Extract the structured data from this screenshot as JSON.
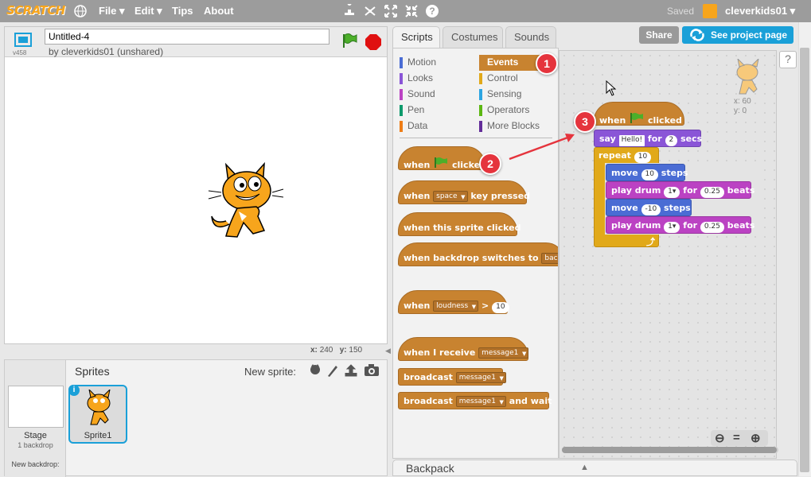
{
  "menu": {
    "logo": "SCRATCH",
    "file": "File ▾",
    "edit": "Edit ▾",
    "tips": "Tips",
    "about": "About",
    "saved": "Saved",
    "user": "cleverkids01 ▾"
  },
  "project": {
    "title": "Untitled-4",
    "byline": "by cleverkids01 (unshared)",
    "version": "v458"
  },
  "stage_coords": {
    "x_label": "x:",
    "x": "240",
    "y_label": "y:",
    "y": "150"
  },
  "sprites": {
    "header": "Sprites",
    "new_sprite": "New sprite:",
    "stage_label": "Stage",
    "stage_sub": "1 backdrop",
    "new_backdrop": "New backdrop:",
    "sprite1": "Sprite1"
  },
  "tabs": {
    "scripts": "Scripts",
    "costumes": "Costumes",
    "sounds": "Sounds"
  },
  "categories": {
    "motion": "Motion",
    "looks": "Looks",
    "sound": "Sound",
    "pen": "Pen",
    "data": "Data",
    "events": "Events",
    "control": "Control",
    "sensing": "Sensing",
    "operators": "Operators",
    "more": "More Blocks"
  },
  "palette": {
    "when": "when",
    "clicked": "clicked",
    "space": "space",
    "key_pressed": "key pressed",
    "when_sprite_clicked": "when this sprite clicked",
    "when_backdrop": "when backdrop switches to",
    "backdrop_opt": "backdr",
    "loudness": "loudness",
    "gt": ">",
    "ten": "10",
    "when_receive": "when I receive",
    "message1": "message1",
    "broadcast": "broadcast",
    "and_wait": "and wait"
  },
  "script": {
    "when": "when",
    "clicked": "clicked",
    "say": "say",
    "hello": "Hello!",
    "for": "for",
    "two": "2",
    "secs": "secs",
    "repeat": "repeat",
    "ten": "10",
    "move": "move",
    "steps": "steps",
    "neg_ten": "-10",
    "play_drum": "play drum",
    "drum_num": "1",
    "beats": "beats",
    "quarter": "0.25"
  },
  "sprite_pos": {
    "x": "x: 60",
    "y": "y: 0"
  },
  "buttons": {
    "share": "Share",
    "see_project": "See project page"
  },
  "backpack": "Backpack",
  "markers": {
    "m1": "1",
    "m2": "2",
    "m3": "3"
  },
  "colors": {
    "events": "#c88330",
    "motion": "#4a6cd4",
    "control": "#e1a91a",
    "sound": "#bb42c3",
    "looks": "#8a55d7",
    "accent": "#1aa0d8",
    "marker": "#e5343d"
  }
}
